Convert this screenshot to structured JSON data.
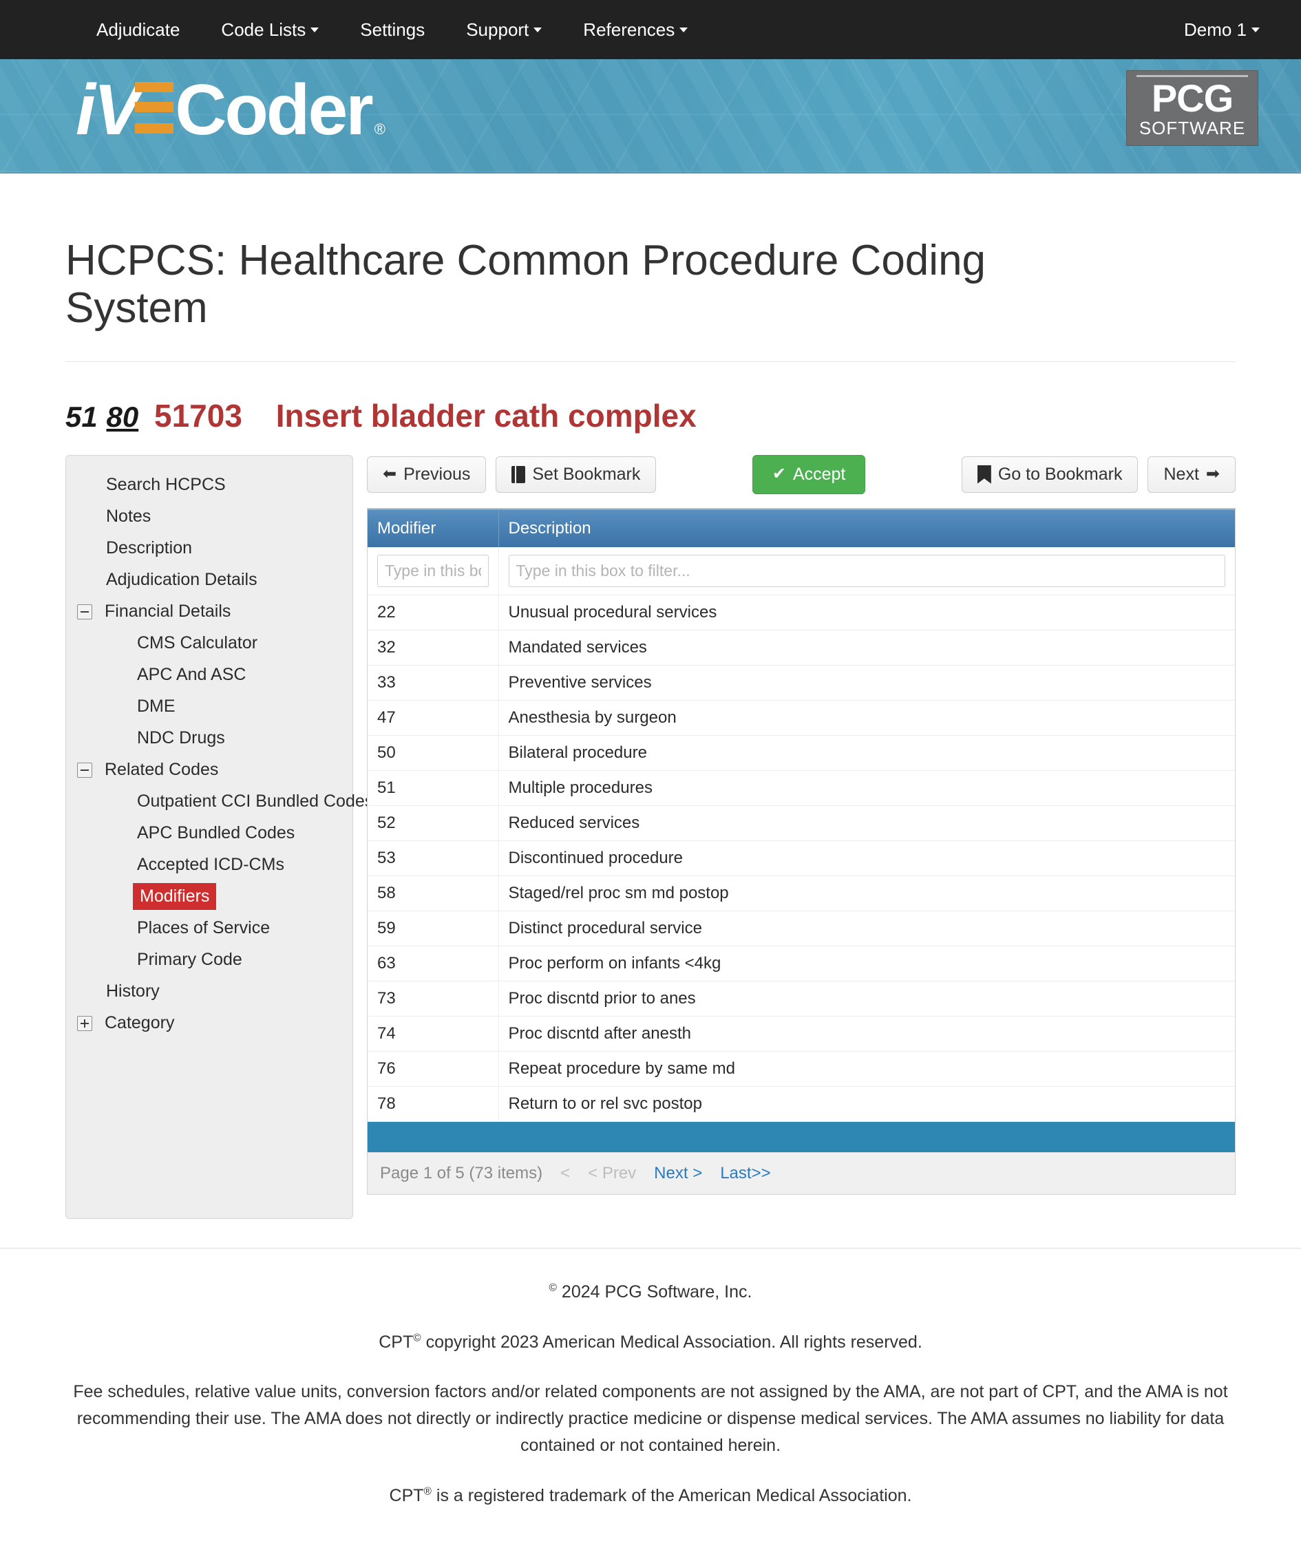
{
  "topnav": {
    "items": [
      {
        "label": "Adjudicate",
        "caret": false
      },
      {
        "label": "Code Lists",
        "caret": true
      },
      {
        "label": "Settings",
        "caret": false
      },
      {
        "label": "Support",
        "caret": true
      },
      {
        "label": "References",
        "caret": true
      }
    ],
    "user": "Demo 1",
    "background": "#222222"
  },
  "banner": {
    "logo": {
      "pre": "i",
      "v": "V",
      "post": "Coder",
      "registered": "®"
    },
    "brand_logo": {
      "main": "PCG",
      "sub": "SOFTWARE"
    },
    "accent_orange": "#e8982b",
    "background": "#4f9cba"
  },
  "page": {
    "title": "HCPCS: Healthcare Common Procedure Coding System",
    "code_header": {
      "modifier_1": "51",
      "modifier_2": "80",
      "code": "51703",
      "description": "Insert bladder cath complex",
      "color": "#b03535"
    }
  },
  "sidebar": {
    "items": [
      {
        "label": "Search HCPCS",
        "level": 0,
        "expander": null,
        "selected": false
      },
      {
        "label": "Notes",
        "level": 0,
        "expander": null,
        "selected": false
      },
      {
        "label": "Description",
        "level": 0,
        "expander": null,
        "selected": false
      },
      {
        "label": "Adjudication Details",
        "level": 0,
        "expander": null,
        "selected": false
      },
      {
        "label": "Financial Details",
        "level": 0,
        "expander": "minus",
        "selected": false
      },
      {
        "label": "CMS Calculator",
        "level": 1,
        "expander": null,
        "selected": false
      },
      {
        "label": "APC And ASC",
        "level": 1,
        "expander": null,
        "selected": false
      },
      {
        "label": "DME",
        "level": 1,
        "expander": null,
        "selected": false
      },
      {
        "label": "NDC Drugs",
        "level": 1,
        "expander": null,
        "selected": false
      },
      {
        "label": "Related Codes",
        "level": 0,
        "expander": "minus",
        "selected": false
      },
      {
        "label": "Outpatient CCI Bundled Codes",
        "level": 1,
        "expander": null,
        "selected": false
      },
      {
        "label": "APC Bundled Codes",
        "level": 1,
        "expander": null,
        "selected": false
      },
      {
        "label": "Accepted ICD-CMs",
        "level": 1,
        "expander": null,
        "selected": false
      },
      {
        "label": "Modifiers",
        "level": 1,
        "expander": null,
        "selected": true
      },
      {
        "label": "Places of Service",
        "level": 1,
        "expander": null,
        "selected": false
      },
      {
        "label": "Primary Code",
        "level": 1,
        "expander": null,
        "selected": false
      },
      {
        "label": "History",
        "level": 0,
        "expander": null,
        "selected": false
      },
      {
        "label": "Category",
        "level": 0,
        "expander": "plus",
        "selected": false
      }
    ],
    "selected_color": "#cf2e2e"
  },
  "toolbar": {
    "previous": "Previous",
    "set_bookmark": "Set Bookmark",
    "accept": "Accept",
    "go_to_bookmark": "Go to Bookmark",
    "next": "Next",
    "accept_color": "#4cb050"
  },
  "grid": {
    "columns": [
      "Modifier",
      "Description"
    ],
    "filters": {
      "modifier_placeholder": "Type in this box",
      "description_placeholder": "Type in this box to filter...",
      "modifier_value": "",
      "description_value": ""
    },
    "rows": [
      {
        "modifier": "22",
        "description": "Unusual procedural services"
      },
      {
        "modifier": "32",
        "description": "Mandated services"
      },
      {
        "modifier": "33",
        "description": "Preventive services"
      },
      {
        "modifier": "47",
        "description": "Anesthesia by surgeon"
      },
      {
        "modifier": "50",
        "description": "Bilateral procedure"
      },
      {
        "modifier": "51",
        "description": "Multiple procedures"
      },
      {
        "modifier": "52",
        "description": "Reduced services"
      },
      {
        "modifier": "53",
        "description": "Discontinued procedure"
      },
      {
        "modifier": "58",
        "description": "Staged/rel proc sm md postop"
      },
      {
        "modifier": "59",
        "description": "Distinct procedural service"
      },
      {
        "modifier": "63",
        "description": "Proc perform on infants <4kg"
      },
      {
        "modifier": "73",
        "description": "Proc discntd prior to anes"
      },
      {
        "modifier": "74",
        "description": "Proc discntd after anesth"
      },
      {
        "modifier": "76",
        "description": "Repeat procedure by same md"
      },
      {
        "modifier": "78",
        "description": "Return to or rel svc postop"
      }
    ],
    "pager": {
      "summary": "Page 1 of 5 (73 items)",
      "first": "<",
      "prev": "< Prev",
      "next": "Next >",
      "last": "Last>>"
    },
    "header_color": "#4a82b5",
    "bar_color": "#2e87b3"
  },
  "footer": {
    "copyright_pre": "©",
    "copyright": " 2024 PCG Software, Inc.",
    "cpt_copyright_pre": "CPT",
    "cpt_copyright_sup": "©",
    "cpt_copyright": " copyright 2023 American Medical Association. All rights reserved.",
    "disclaimer": "Fee schedules, relative value units, conversion factors and/or related components are not assigned by the AMA, are not part of CPT, and the AMA is not recommending their use. The AMA does not directly or indirectly practice medicine or dispense medical services. The AMA assumes no liability for data contained or not contained herein.",
    "trademark_pre": "CPT",
    "trademark_sup": "®",
    "trademark": " is a registered trademark of the American Medical Association."
  }
}
